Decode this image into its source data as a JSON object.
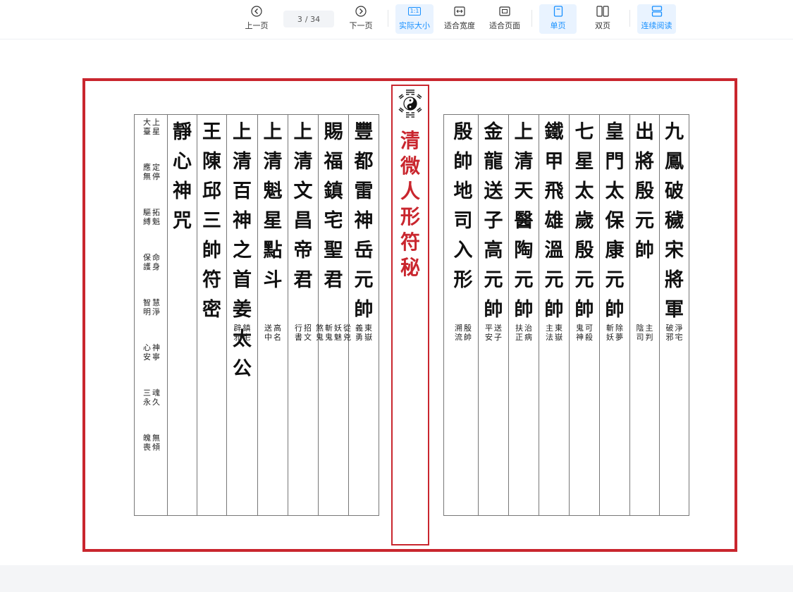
{
  "toolbar": {
    "prev_label": "上一页",
    "page_current": "3",
    "page_total": "/ 34",
    "next_label": "下一页",
    "actual_size_label": "实际大小",
    "actual_size_icon_text": "1:1",
    "fit_width_label": "适合宽度",
    "fit_page_label": "适合页面",
    "single_page_label": "单页",
    "double_page_label": "双页",
    "continuous_label": "连续阅读",
    "accent": "#1890ff"
  },
  "document": {
    "border_color": "#c9262e",
    "center_title": [
      "清",
      "微",
      "人",
      "形",
      "符",
      "秘"
    ],
    "right_columns": [
      {
        "big": [
          "九",
          "鳳",
          "破",
          "穢",
          "宋",
          "將",
          "軍"
        ],
        "small": [
          [
            "淨",
            "宅"
          ],
          [
            "破",
            "邪"
          ]
        ]
      },
      {
        "big": [
          "出",
          "將",
          "殷",
          "元",
          "帥"
        ],
        "small": [
          [
            "主",
            "判"
          ],
          [
            "陰",
            "司"
          ]
        ]
      },
      {
        "big": [
          "皇",
          "門",
          "太",
          "保",
          "康",
          "元",
          "帥"
        ],
        "small": [
          [
            "除",
            "夢"
          ],
          [
            "斬",
            "妖"
          ]
        ]
      },
      {
        "big": [
          "七",
          "星",
          "太",
          "歲",
          "殷",
          "元",
          "帥"
        ],
        "small": [
          [
            "可",
            "殺"
          ],
          [
            "鬼",
            "神"
          ]
        ]
      },
      {
        "big": [
          "鐵",
          "甲",
          "飛",
          "雄",
          "溫",
          "元",
          "帥"
        ],
        "small": [
          [
            "東",
            "嶽"
          ],
          [
            "主",
            "法"
          ]
        ]
      },
      {
        "big": [
          "上",
          "清",
          "天",
          "醫",
          "陶",
          "元",
          "帥"
        ],
        "small": [
          [
            "治",
            "病"
          ],
          [
            "扶",
            "正"
          ]
        ]
      },
      {
        "big": [
          "金",
          "龍",
          "送",
          "子",
          "高",
          "元",
          "帥"
        ],
        "small": [
          [
            "送",
            "子"
          ],
          [
            "平",
            "安"
          ]
        ]
      },
      {
        "big": [
          "殷",
          "帥",
          "地",
          "司",
          "入",
          "形"
        ],
        "small": [
          [
            "殷",
            "帥"
          ],
          [
            "溯",
            "流"
          ]
        ]
      }
    ],
    "left_columns": [
      {
        "big": [
          "豐",
          "都",
          "雷",
          "神",
          "岳",
          "元",
          "帥"
        ],
        "small": [
          [
            "東",
            "嶽"
          ],
          [
            "義",
            "勇"
          ]
        ]
      },
      {
        "big": [
          "賜",
          "福",
          "鎮",
          "宅",
          "聖",
          "君"
        ],
        "small": [
          [
            "從",
            "兇"
          ],
          [
            "妖",
            "魅"
          ],
          [
            "斬",
            "鬼"
          ],
          [
            "煞",
            "鬼"
          ]
        ]
      },
      {
        "big": [
          "上",
          "清",
          "文",
          "昌",
          "帝",
          "君"
        ],
        "small": [
          [
            "招",
            "文"
          ],
          [
            "行",
            "書"
          ]
        ]
      },
      {
        "big": [
          "上",
          "清",
          "魁",
          "星",
          "點",
          "斗"
        ],
        "small": [
          [
            "高",
            "名"
          ],
          [
            "送",
            "中"
          ]
        ]
      },
      {
        "big": [
          "上",
          "清",
          "百",
          "神",
          "之",
          "首",
          "姜",
          "太",
          "公"
        ],
        "small": [
          [
            "鎮",
            "宅"
          ],
          [
            "辟",
            "邪"
          ]
        ]
      },
      {
        "big": [
          "王",
          "陳",
          "邱",
          "三",
          "帥",
          "符",
          "密"
        ],
        "small": []
      },
      {
        "big": [
          "靜",
          "心",
          "神",
          "咒"
        ],
        "small": []
      }
    ],
    "note_pairs": [
      [
        [
          "上",
          "星"
        ],
        [
          "大",
          "臺"
        ]
      ],
      [
        [
          "定",
          "停"
        ],
        [
          "應",
          "無"
        ]
      ],
      [
        [
          "拓",
          "魁"
        ],
        [
          "驅",
          "縛"
        ]
      ],
      [
        [
          "命",
          "身"
        ],
        [
          "保",
          "護"
        ]
      ],
      [
        [
          "慧",
          "淨"
        ],
        [
          "智",
          "明"
        ]
      ],
      [
        [
          "神",
          "寧"
        ],
        [
          "心",
          "安"
        ]
      ],
      [
        [
          "魂",
          "久"
        ],
        [
          "三",
          "永"
        ]
      ],
      [
        [
          "無",
          "傾"
        ],
        [
          "魄",
          "喪"
        ]
      ]
    ]
  }
}
